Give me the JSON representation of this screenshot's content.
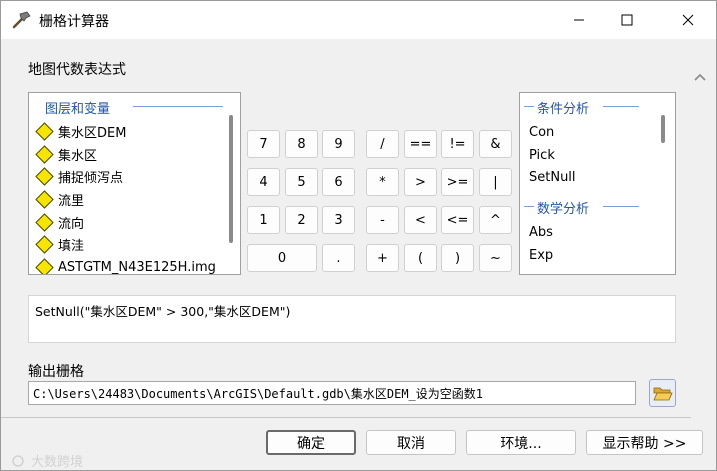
{
  "window": {
    "title": "栅格计算器"
  },
  "expression_label": "地图代数表达式",
  "layers_panel": {
    "header": "图层和变量",
    "items": [
      "集水区DEM",
      "集水区",
      "捕捉倾泻点",
      "流里",
      "流向",
      "填洼",
      "ASTGTM_N43E125H.img"
    ]
  },
  "keypad": {
    "numbers": [
      "7",
      "8",
      "9",
      "4",
      "5",
      "6",
      "1",
      "2",
      "3",
      "0",
      "."
    ],
    "operators": [
      "/",
      "==",
      "!=",
      "&",
      "*",
      ">",
      ">=",
      "|",
      "-",
      "<",
      "<=",
      "^",
      "+",
      "(",
      ")",
      "~"
    ]
  },
  "functions_panel": {
    "groups": [
      {
        "header": "条件分析",
        "items": [
          "Con",
          "Pick",
          "SetNull"
        ]
      },
      {
        "header": "数学分析",
        "items": [
          "Abs",
          "Exp"
        ]
      }
    ]
  },
  "expression_value": "SetNull(\"集水区DEM\" > 300,\"集水区DEM\")",
  "output_label": "输出栅格",
  "output_path": "C:\\Users\\24483\\Documents\\ArcGIS\\Default.gdb\\集水区DEM_设为空函数1",
  "buttons": {
    "ok": "确定",
    "cancel": "取消",
    "environments": "环境...",
    "show_help": "显示帮助 >>"
  },
  "watermark": "大数跨境",
  "icons": [
    "hammer-icon",
    "minimize-icon",
    "maximize-icon",
    "close-icon",
    "folder-open-icon",
    "scroll-up-icon",
    "diamond-layer-icon"
  ]
}
